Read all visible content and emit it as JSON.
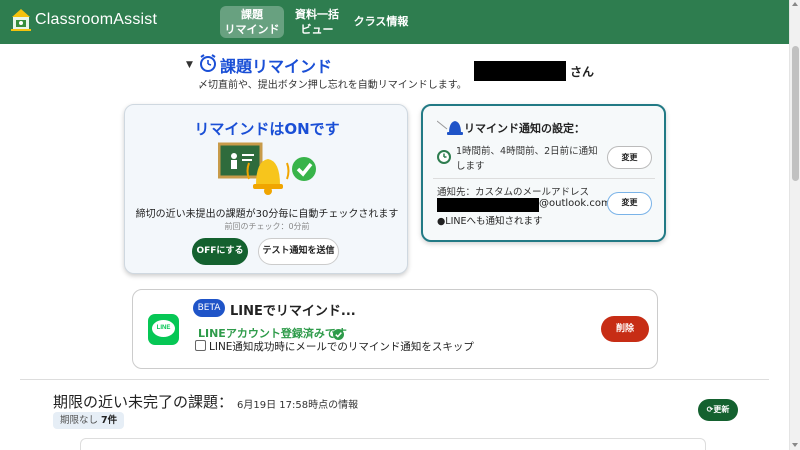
{
  "header": {
    "app_name": "ClassroomAssist",
    "nav": [
      {
        "label_line1": "課題",
        "label_line2": "リマインド",
        "active": true
      },
      {
        "label_line1": "資料一括",
        "label_line2": "ビュー",
        "active": false
      },
      {
        "label_line1": "クラス情報",
        "label_line2": "",
        "active": false
      }
    ]
  },
  "section": {
    "toggle": "▼",
    "title": "課題リマインド",
    "subtitle": "〆切直前や、提出ボタン押し忘れを自動リマインドします。",
    "user_suffix": "さん"
  },
  "remind_card": {
    "title": "リマインドはONです",
    "description": "締切の近い未提出の課題が30分毎に自動チェックされます",
    "last_check": "前回のチェック：0分前",
    "off_button": "OFFにする",
    "test_button": "テスト通知を送信"
  },
  "settings_card": {
    "title": "リマインド通知の設定：",
    "times": "1時間前、4時間前、2日前に通知します",
    "change_button_1": "変更",
    "notify_to": "通知先：カスタムのメールアドレス",
    "email_domain": "@outlook.com",
    "line_note": "●LINEへも通知されます",
    "change_button_2": "変更"
  },
  "line_card": {
    "logo_text": "LINE",
    "beta": "BETA",
    "title": "LINEでリマインド...",
    "registered": "LINEアカウント登録済みです",
    "skip_label": "LINE通知成功時にメールでのリマインド通知をスキップ",
    "delete_button": "削除"
  },
  "upcoming": {
    "title": "期限の近い未完了の課題：",
    "date_info": "6月19日 17:58時点の情報",
    "no_deadline_label": "期限なし",
    "no_deadline_count": "7件",
    "refresh_button": "更新"
  },
  "colors": {
    "header_green": "#2e7d4f",
    "title_blue": "#1a4fd6",
    "button_green": "#14612f",
    "delete_red": "#c72d15",
    "line_green": "#06c755",
    "teal_border": "#227a85"
  }
}
